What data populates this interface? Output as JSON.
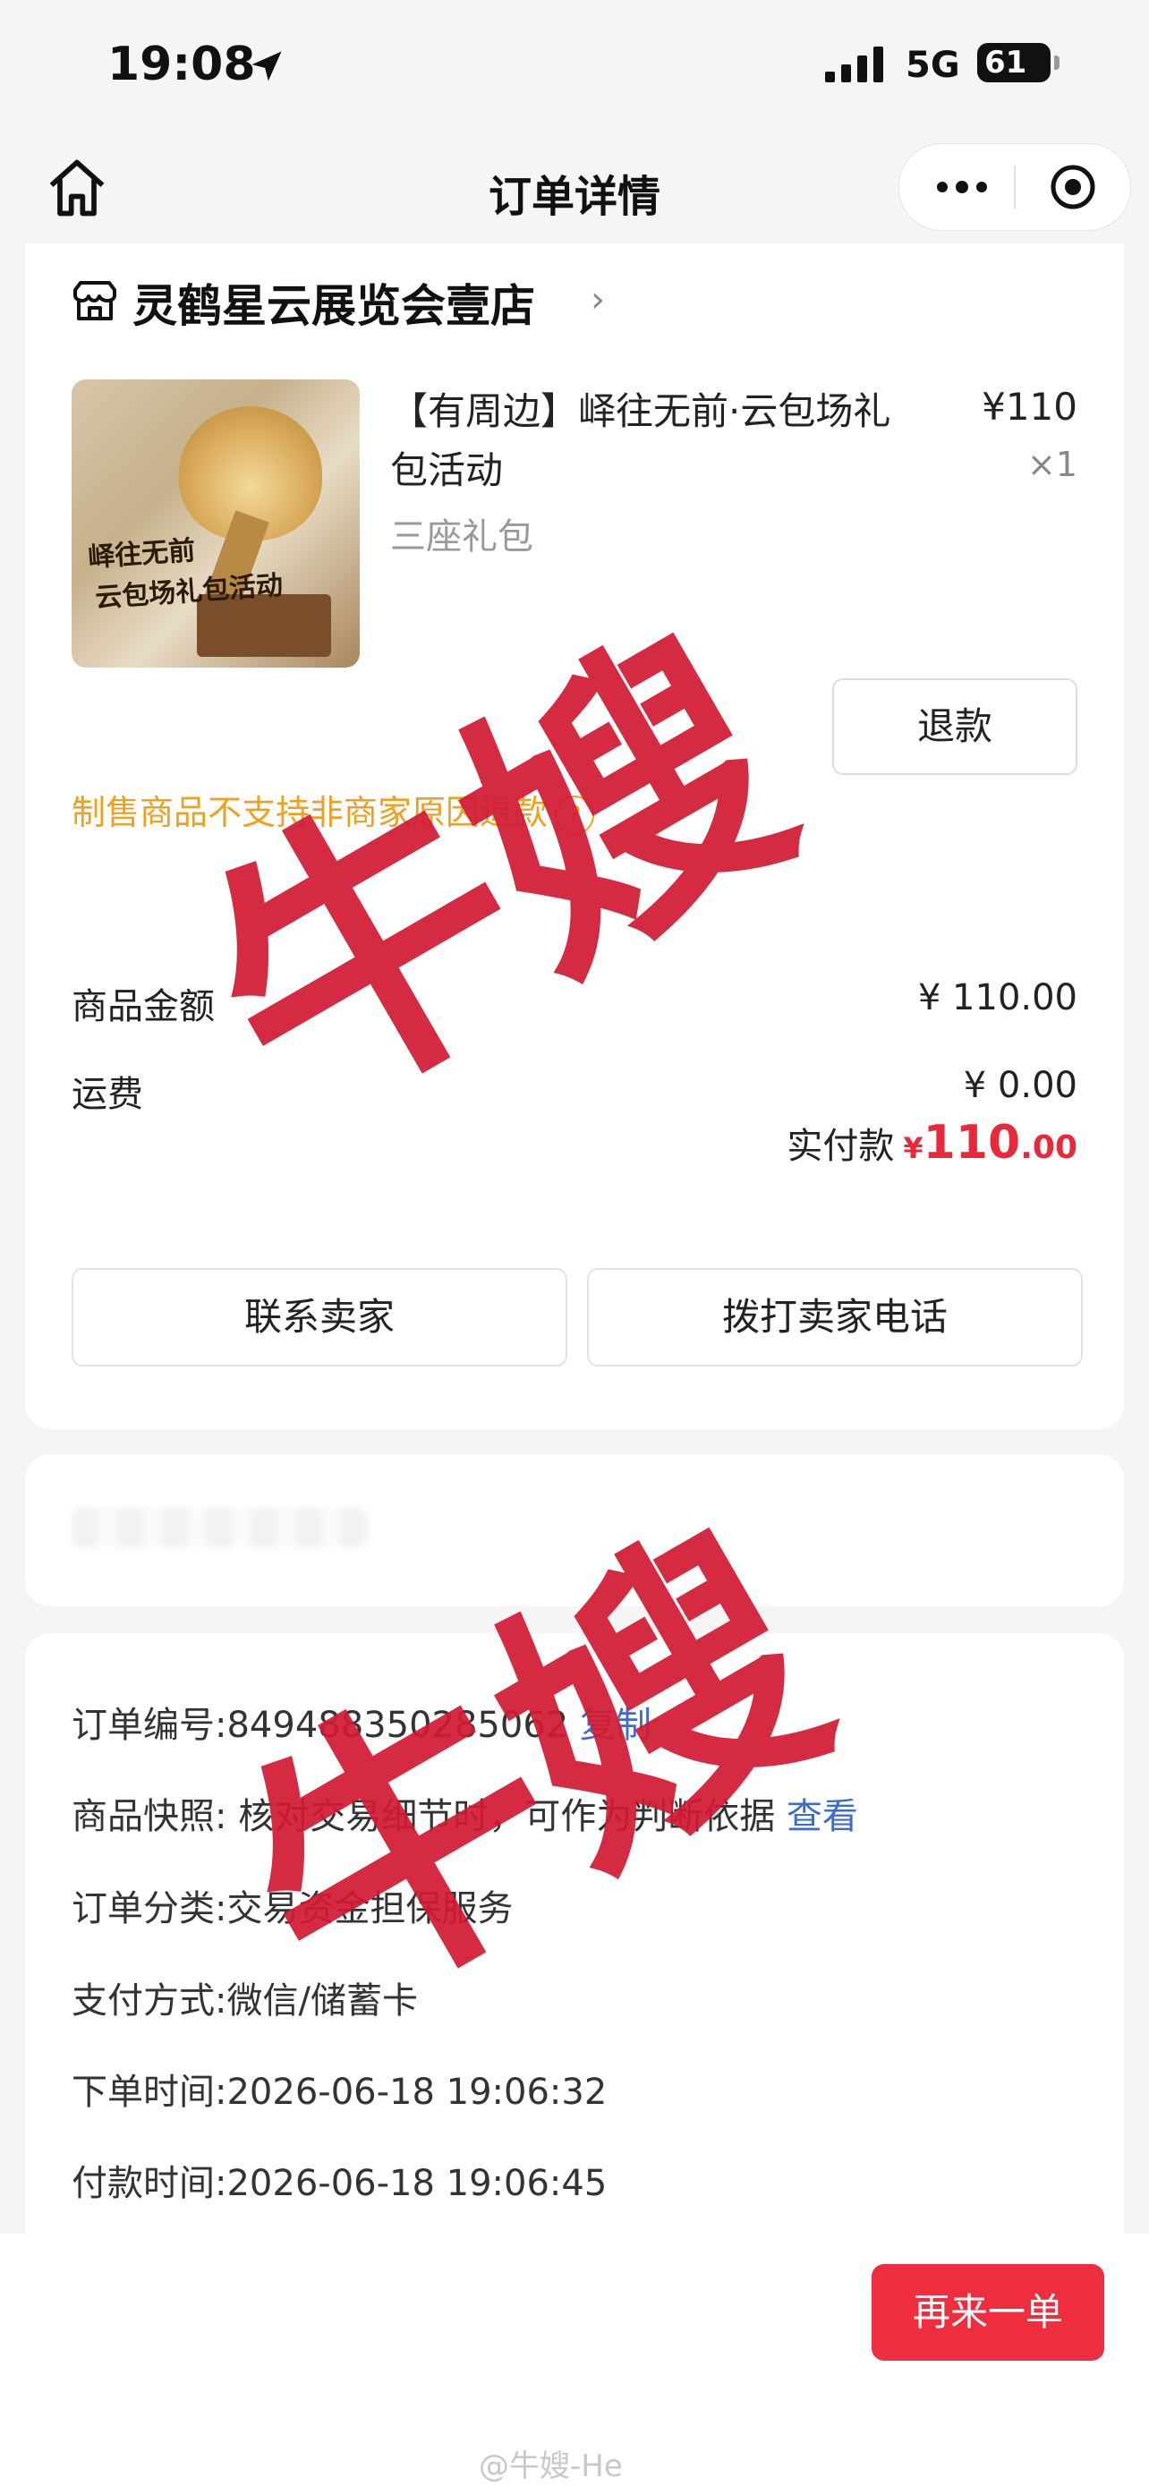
{
  "status_bar": {
    "time": "19:08",
    "network": "5G",
    "battery": "61"
  },
  "nav": {
    "title": "订单详情"
  },
  "shop": {
    "name": "灵鹤星云展览会壹店"
  },
  "product": {
    "image_text_line1": "峄往无前",
    "image_text_line2": "云包场礼包活动",
    "title": "【有周边】峄往无前·云包场礼包活动",
    "spec": "三座礼包",
    "price": "¥110",
    "qty": "×1"
  },
  "refund_label": "退款",
  "notice": {
    "text": "制售商品不支持非商家原因退款",
    "icon": "question-icon"
  },
  "amounts": {
    "goods_label": "商品金额",
    "goods_value": "¥ 110.00",
    "shipping_label": "运费",
    "shipping_value": "¥ 0.00",
    "paid_label": "实付款",
    "paid_currency": "¥",
    "paid_int": "110",
    "paid_dec": ".00"
  },
  "actions": {
    "contact": "联系卖家",
    "call": "拨打卖家电话"
  },
  "order_info": {
    "order_no_label": "订单编号:",
    "order_no": "849488350285062",
    "order_no_action": "复制",
    "snapshot_label": "商品快照:",
    "snapshot_text": "核对交易细节时，可作为判断依据",
    "snapshot_action": "查看",
    "category_label": "订单分类:",
    "category": "交易资金担保服务",
    "payment_label": "支付方式:",
    "payment": "微信/储蓄卡",
    "created_label": "下单时间:",
    "created": "2026-06-18 19:06:32",
    "paid_label": "付款时间:",
    "paid": "2026-06-18 19:06:45"
  },
  "footer": {
    "again": "再来一单",
    "watermark": "@牛嫂-He"
  },
  "stamps": {
    "text": "牛嫂"
  },
  "colors": {
    "accent_red": "#ee2d3f",
    "warning": "#f0a020",
    "link": "#3b6bd6"
  }
}
